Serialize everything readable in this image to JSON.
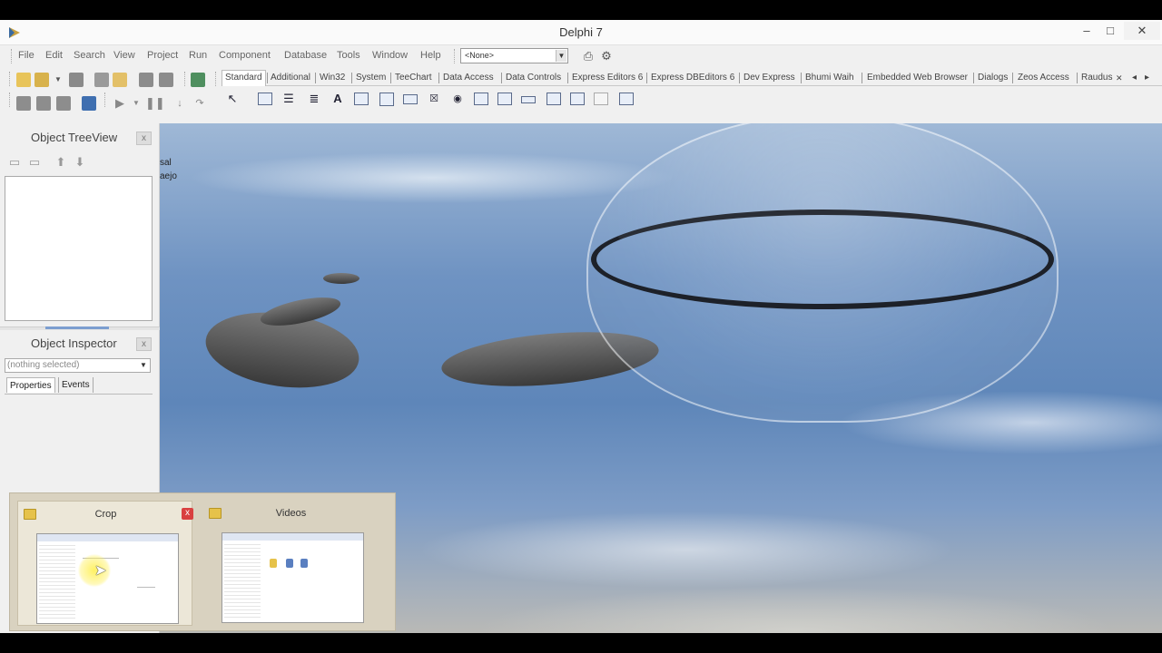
{
  "window": {
    "title": "Delphi 7",
    "controls": {
      "minimize": "–",
      "maximize": "□",
      "close": "✕"
    }
  },
  "menu": [
    "File",
    "Edit",
    "Search",
    "View",
    "Project",
    "Run",
    "Component",
    "Database",
    "Tools",
    "Window",
    "Help"
  ],
  "desktop_combo": {
    "value": "<None>"
  },
  "palette_tabs": [
    "Standard",
    "Additional",
    "Win32",
    "System",
    "TeeChart",
    "Data Access",
    "Data Controls",
    "Express Editors 6",
    "Express DBEditors 6",
    "Dev Express",
    "Bhumi Waih",
    "Embedded Web Browser",
    "Dialogs",
    "Zeos Access",
    "Raudus"
  ],
  "palette_scroll": {
    "close": "✕",
    "left": "◂",
    "right": "▸"
  },
  "object_treeview": {
    "title": "Object TreeView",
    "close": "x"
  },
  "object_inspector": {
    "title": "Object Inspector",
    "close": "x",
    "selector_value": "(nothing selected)",
    "tabs": [
      "Properties",
      "Events"
    ]
  },
  "desktop_labels": {
    "line1": "sal",
    "line2": "aejo"
  },
  "taskbar_thumbnails": [
    {
      "title": "Crop",
      "close": "x",
      "hovered": true
    },
    {
      "title": "Videos",
      "hovered": false
    }
  ],
  "colors": {
    "chrome": "#f0f0f0",
    "thumb_popup": "#d9d2c0",
    "thumb_close": "#d94040",
    "cursor_highlight": "#fff05a"
  }
}
